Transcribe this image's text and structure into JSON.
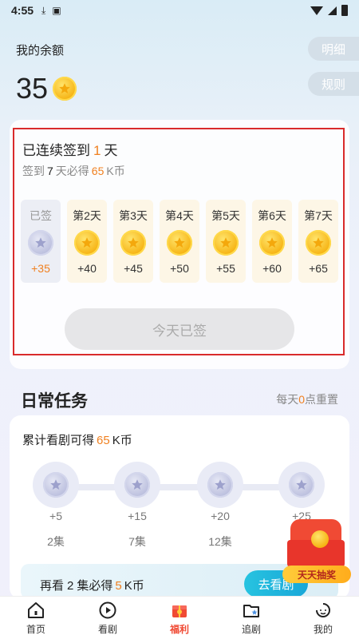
{
  "status_bar": {
    "time": "4:55"
  },
  "balance": {
    "title": "我的余额",
    "amount": "35"
  },
  "buttons": {
    "detail": "明细",
    "rules": "规则"
  },
  "sign_in": {
    "streak_prefix": "已连续签到",
    "streak_days": "1",
    "streak_suffix": "天",
    "goal_prefix": "签到",
    "goal_days": "7",
    "goal_mid": "天必得",
    "goal_reward": "65",
    "goal_unit": "K币",
    "days": [
      {
        "label": "已签",
        "amount": "+35",
        "signed": true
      },
      {
        "label": "第2天",
        "amount": "+40",
        "signed": false
      },
      {
        "label": "第3天",
        "amount": "+45",
        "signed": false
      },
      {
        "label": "第4天",
        "amount": "+50",
        "signed": false
      },
      {
        "label": "第5天",
        "amount": "+55",
        "signed": false
      },
      {
        "label": "第6天",
        "amount": "+60",
        "signed": false
      },
      {
        "label": "第7天",
        "amount": "+65",
        "signed": false
      }
    ],
    "today_button": "今天已签"
  },
  "daily_tasks": {
    "title": "日常任务",
    "reset_prefix": "每天",
    "reset_hour": "0",
    "reset_suffix": "点重置",
    "watch_prefix": "累计看剧可得",
    "watch_total": "65",
    "watch_unit": "K币",
    "milestones": [
      {
        "amount": "+5",
        "episodes": "2集"
      },
      {
        "amount": "+15",
        "episodes": "7集"
      },
      {
        "amount": "+20",
        "episodes": "12集"
      },
      {
        "amount": "+25",
        "episodes": ""
      }
    ],
    "banner_prefix": "再看",
    "banner_episodes": "2",
    "banner_mid": "集必得",
    "banner_reward": "5",
    "banner_unit": "K币",
    "banner_button": "去看剧"
  },
  "lottery": {
    "label": "天天抽奖"
  },
  "tabs": [
    {
      "label": "首页",
      "icon": "home-icon"
    },
    {
      "label": "看剧",
      "icon": "play-icon"
    },
    {
      "label": "福利",
      "icon": "gift-icon",
      "active": true
    },
    {
      "label": "追剧",
      "icon": "folder-star-icon"
    },
    {
      "label": "我的",
      "icon": "profile-icon"
    }
  ],
  "colors": {
    "accent_orange": "#f08020",
    "active_red": "#f04a34",
    "highlight_border": "#d92b2b"
  }
}
